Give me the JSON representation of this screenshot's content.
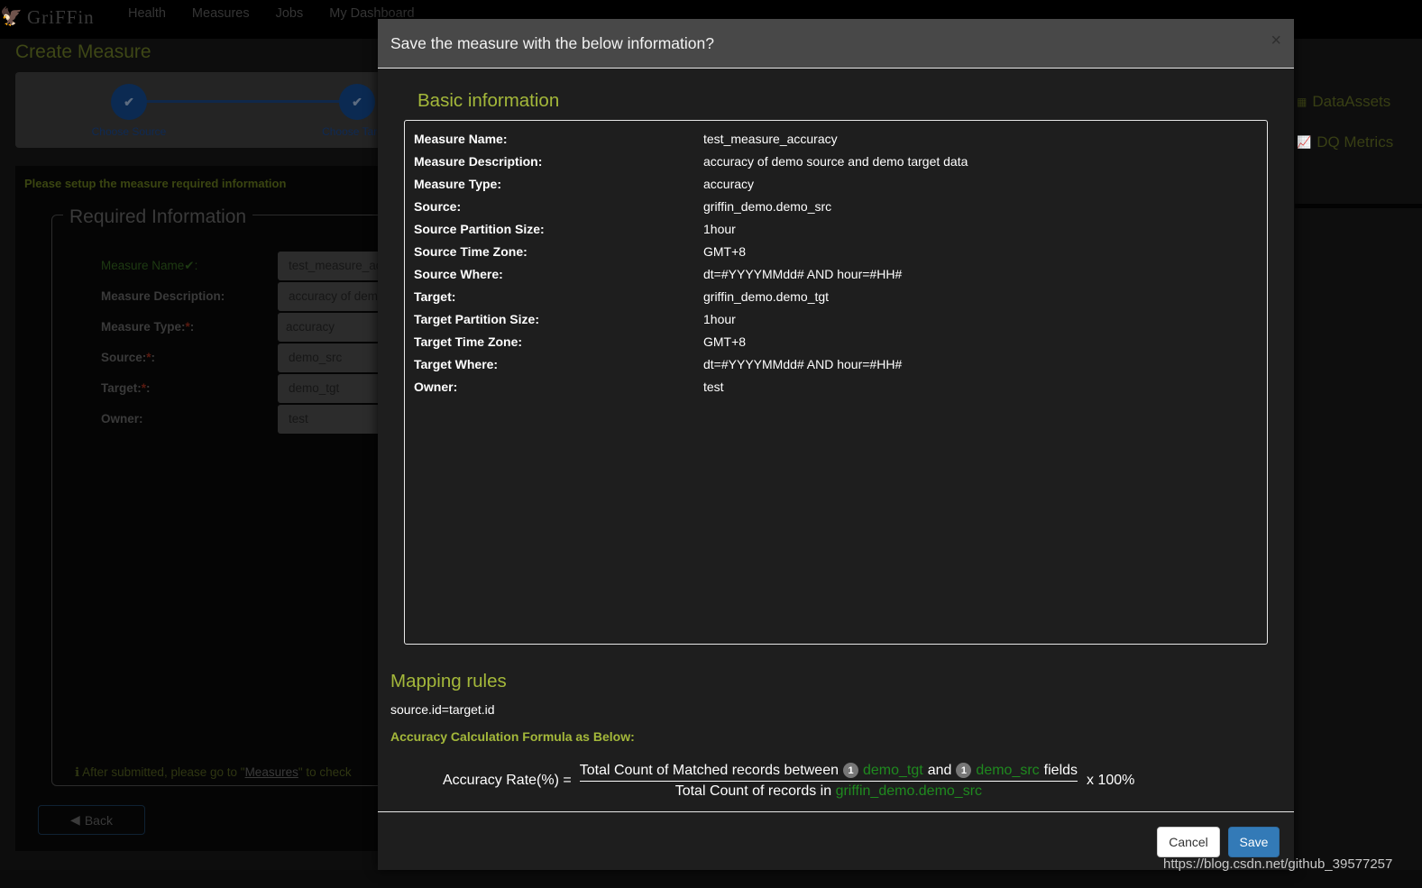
{
  "navbar": {
    "logo_text": "GriFFin",
    "links": [
      "Health",
      "Measures",
      "Jobs",
      "My Dashboard"
    ]
  },
  "page": {
    "title": "Create Measure",
    "steps": [
      {
        "label": "Choose Source",
        "status": "done"
      },
      {
        "label": "Choose Target",
        "status": "done"
      }
    ],
    "setup_note": "Please setup the measure required information",
    "legend": "Required Information",
    "form": [
      {
        "label": "Measure Name",
        "suffix": "✔:",
        "required": false,
        "valid": true,
        "value": "test_measure_accuracy"
      },
      {
        "label": "Measure Description:",
        "suffix": "",
        "required": false,
        "valid": false,
        "value": "accuracy of demo source and demo target data"
      },
      {
        "label": "Measure Type:",
        "suffix": ":",
        "required": true,
        "valid": false,
        "value": "accuracy"
      },
      {
        "label": "Source:",
        "suffix": ":",
        "required": true,
        "valid": false,
        "value": "demo_src"
      },
      {
        "label": "Target:",
        "suffix": ":",
        "required": true,
        "valid": false,
        "value": "demo_tgt"
      },
      {
        "label": "Owner:",
        "suffix": "",
        "required": false,
        "valid": false,
        "value": "test"
      }
    ],
    "required_mark": "*",
    "after_note_prefix": "After submitted, please go to \"",
    "after_note_link": "Measures",
    "after_note_suffix": "\" to check",
    "back_label": "Back"
  },
  "sidebar": {
    "items": [
      {
        "label": "DataAssets",
        "icon": "table-icon"
      },
      {
        "label": "DQ Metrics",
        "icon": "line-chart-icon"
      }
    ]
  },
  "modal": {
    "title": "Save the measure with the below information?",
    "close_glyph": "×",
    "basic_title": "Basic information",
    "rows": [
      {
        "key": "Measure Name:",
        "value": "test_measure_accuracy"
      },
      {
        "key": "Measure Description:",
        "value": "accuracy of demo source and demo target data"
      },
      {
        "key": "Measure Type:",
        "value": "accuracy"
      },
      {
        "key": "Source:",
        "value": "griffin_demo.demo_src"
      },
      {
        "key": "Source Partition Size:",
        "value": "1hour"
      },
      {
        "key": "Source Time Zone:",
        "value": "GMT+8"
      },
      {
        "key": "Source Where:",
        "value": "dt=#YYYYMMdd# AND hour=#HH#"
      },
      {
        "key": "Target:",
        "value": "griffin_demo.demo_tgt"
      },
      {
        "key": "Target Partition Size:",
        "value": "1hour"
      },
      {
        "key": "Target Time Zone:",
        "value": "GMT+8"
      },
      {
        "key": "Target Where:",
        "value": "dt=#YYYYMMdd# AND hour=#HH#"
      },
      {
        "key": "Owner:",
        "value": "test"
      }
    ],
    "mapping_title": "Mapping rules",
    "mapping_rule": "source.id=target.id",
    "formula_title": "Accuracy Calculation Formula as Below:",
    "formula": {
      "lhs": "Accuracy Rate(%) =",
      "num_prefix": "Total Count of Matched records between",
      "badge_1": "1",
      "target_name": "demo_tgt",
      "and_text": "and",
      "badge_2": "1",
      "source_name": "demo_src",
      "num_suffix": "fields",
      "den_prefix": "Total Count of records in",
      "den_table": "griffin_demo.demo_src",
      "rhs": "x 100%"
    },
    "cancel_label": "Cancel",
    "save_label": "Save"
  },
  "watermark": "https://blog.csdn.net/github_39577257"
}
